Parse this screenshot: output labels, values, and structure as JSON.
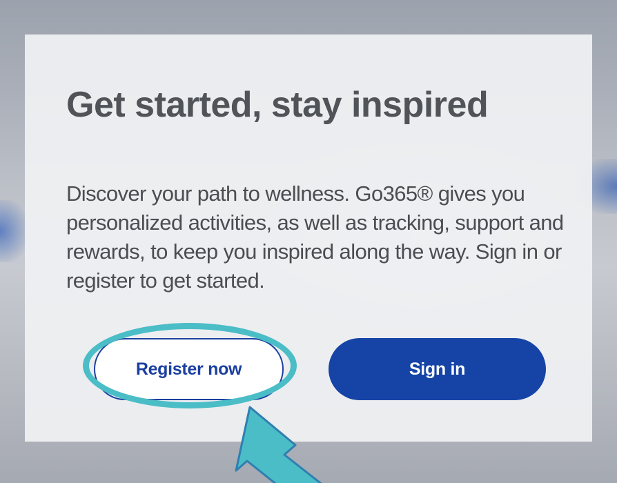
{
  "hero": {
    "title": "Get started, stay inspired",
    "description": "Discover your path to wellness. Go365® gives you personalized activities, as well as tracking, support and rewards, to keep you inspired along the way. Sign in or register to get started."
  },
  "actions": {
    "register_label": "Register now",
    "signin_label": "Sign in"
  },
  "annotation": {
    "highlight_color": "#4bbdc7",
    "arrow_color": "#4bbdc7",
    "highlight_icon": "ellipse-outline",
    "arrow_icon": "arrow-up-left"
  },
  "colors": {
    "primary_blue": "#1544a6",
    "title_gray": "#505357",
    "card_bg": "#f0f1f3"
  }
}
